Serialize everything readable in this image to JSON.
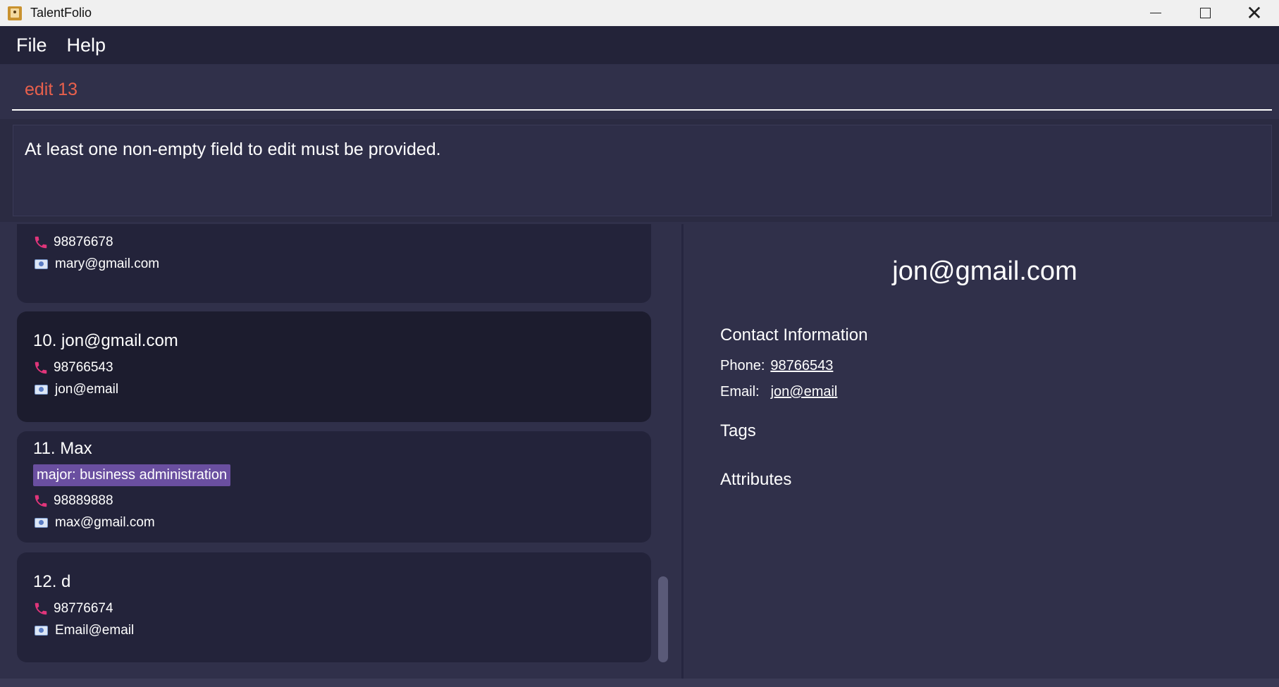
{
  "window": {
    "title": "TalentFolio"
  },
  "menu": {
    "file": "File",
    "help": "Help"
  },
  "command": {
    "value": "edit 13"
  },
  "result": {
    "message": "At least one non-empty field to edit must be provided."
  },
  "list": {
    "cards": [
      {
        "name": "",
        "tags": [],
        "phone": "98876678",
        "email": "mary@gmail.com"
      },
      {
        "name": "10. jon@gmail.com",
        "tags": [],
        "phone": "98766543",
        "email": "jon@email"
      },
      {
        "name": "11. Max",
        "tags": [
          "major: business administration"
        ],
        "phone": "98889888",
        "email": "max@gmail.com"
      },
      {
        "name": "12. d",
        "tags": [],
        "phone": "98776674",
        "email": "Email@email"
      }
    ]
  },
  "details": {
    "title": "jon@gmail.com",
    "contact_heading": "Contact Information",
    "phone_label": "Phone:",
    "phone_value": "98766543",
    "email_label": "Email:",
    "email_value": "jon@email",
    "tags_heading": "Tags",
    "attributes_heading": "Attributes"
  },
  "colors": {
    "accent_command": "#e8604c",
    "tag_bg": "#6a4fa0",
    "phone_icon": "#e0357a"
  },
  "icons": {
    "app": "app-icon",
    "phone": "phone-icon",
    "email": "mail-icon"
  }
}
